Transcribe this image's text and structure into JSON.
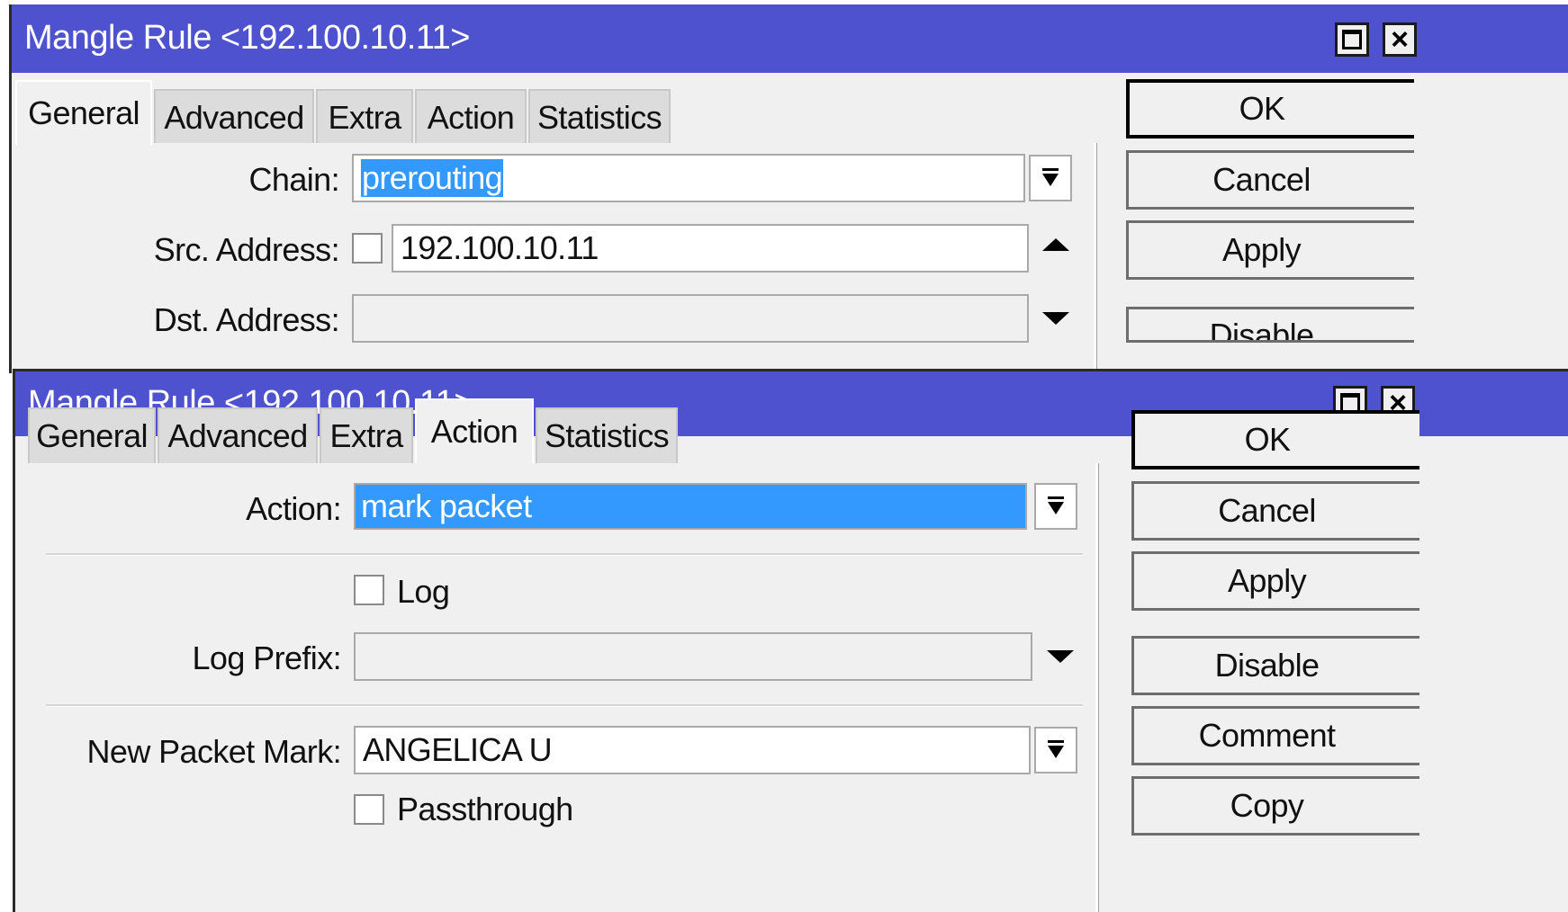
{
  "window_back": {
    "title": "Mangle Rule <192.100.10.11>",
    "tabs": [
      "General",
      "Advanced",
      "Extra",
      "Action",
      "Statistics"
    ],
    "active_tab": "General",
    "chain_label": "Chain:",
    "chain_value": "prerouting",
    "src_address_label": "Src. Address:",
    "src_address_value": "192.100.10.11",
    "dst_address_label": "Dst. Address:",
    "dst_address_value": "",
    "buttons": {
      "ok": "OK",
      "cancel": "Cancel",
      "apply": "Apply",
      "disable": "Disable"
    }
  },
  "window_front": {
    "title": "Mangle Rule <192.100.10.11>",
    "tabs": [
      "General",
      "Advanced",
      "Extra",
      "Action",
      "Statistics"
    ],
    "active_tab": "Action",
    "action_label": "Action:",
    "action_value": "mark packet",
    "log_label": "Log",
    "log_checked": false,
    "log_prefix_label": "Log Prefix:",
    "log_prefix_value": "",
    "new_packet_mark_label": "New Packet Mark:",
    "new_packet_mark_value": "ANGELICA U",
    "passthrough_label": "Passthrough",
    "passthrough_checked": false,
    "buttons": {
      "ok": "OK",
      "cancel": "Cancel",
      "apply": "Apply",
      "disable": "Disable",
      "comment": "Comment",
      "copy": "Copy"
    }
  },
  "colors": {
    "titlebar": "#4f52cf",
    "selection": "#3399ff",
    "window_bg": "#f0f0f0"
  },
  "icons": {
    "maximize": "maximize-icon",
    "close": "close-icon",
    "dropdown": "dropdown-arrow-icon",
    "expand_up": "arrow-up-icon",
    "expand_down": "arrow-down-icon"
  }
}
